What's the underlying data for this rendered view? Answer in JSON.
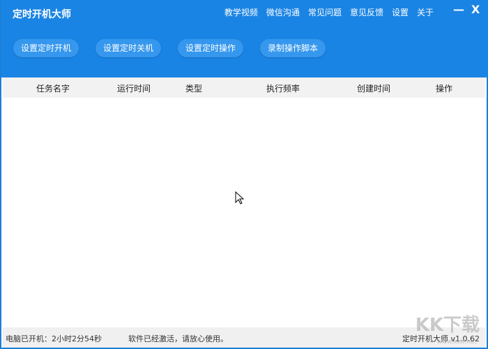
{
  "app": {
    "title": "定时开机大师"
  },
  "topnav": [
    "教学视频",
    "微信沟通",
    "常见问题",
    "意见反馈",
    "设置",
    "关于"
  ],
  "window_controls": {
    "minimize": "—",
    "close": "X"
  },
  "actions": [
    "设置定时开机",
    "设置定时关机",
    "设置定时操作",
    "录制操作脚本"
  ],
  "table": {
    "columns": [
      "任务名字",
      "运行时间",
      "类型",
      "执行频率",
      "创建时间",
      "操作"
    ],
    "rows": []
  },
  "status": {
    "uptime": "电脑已开机：2小时2分54秒",
    "activation": "软件已经激活，请放心使用。",
    "version": "定时开机大师 v1.0.62"
  },
  "watermark": {
    "logo": "KK下载",
    "url": "www.kkx.net"
  },
  "colors": {
    "header": "#1a84e4",
    "button": "#3597ee"
  }
}
